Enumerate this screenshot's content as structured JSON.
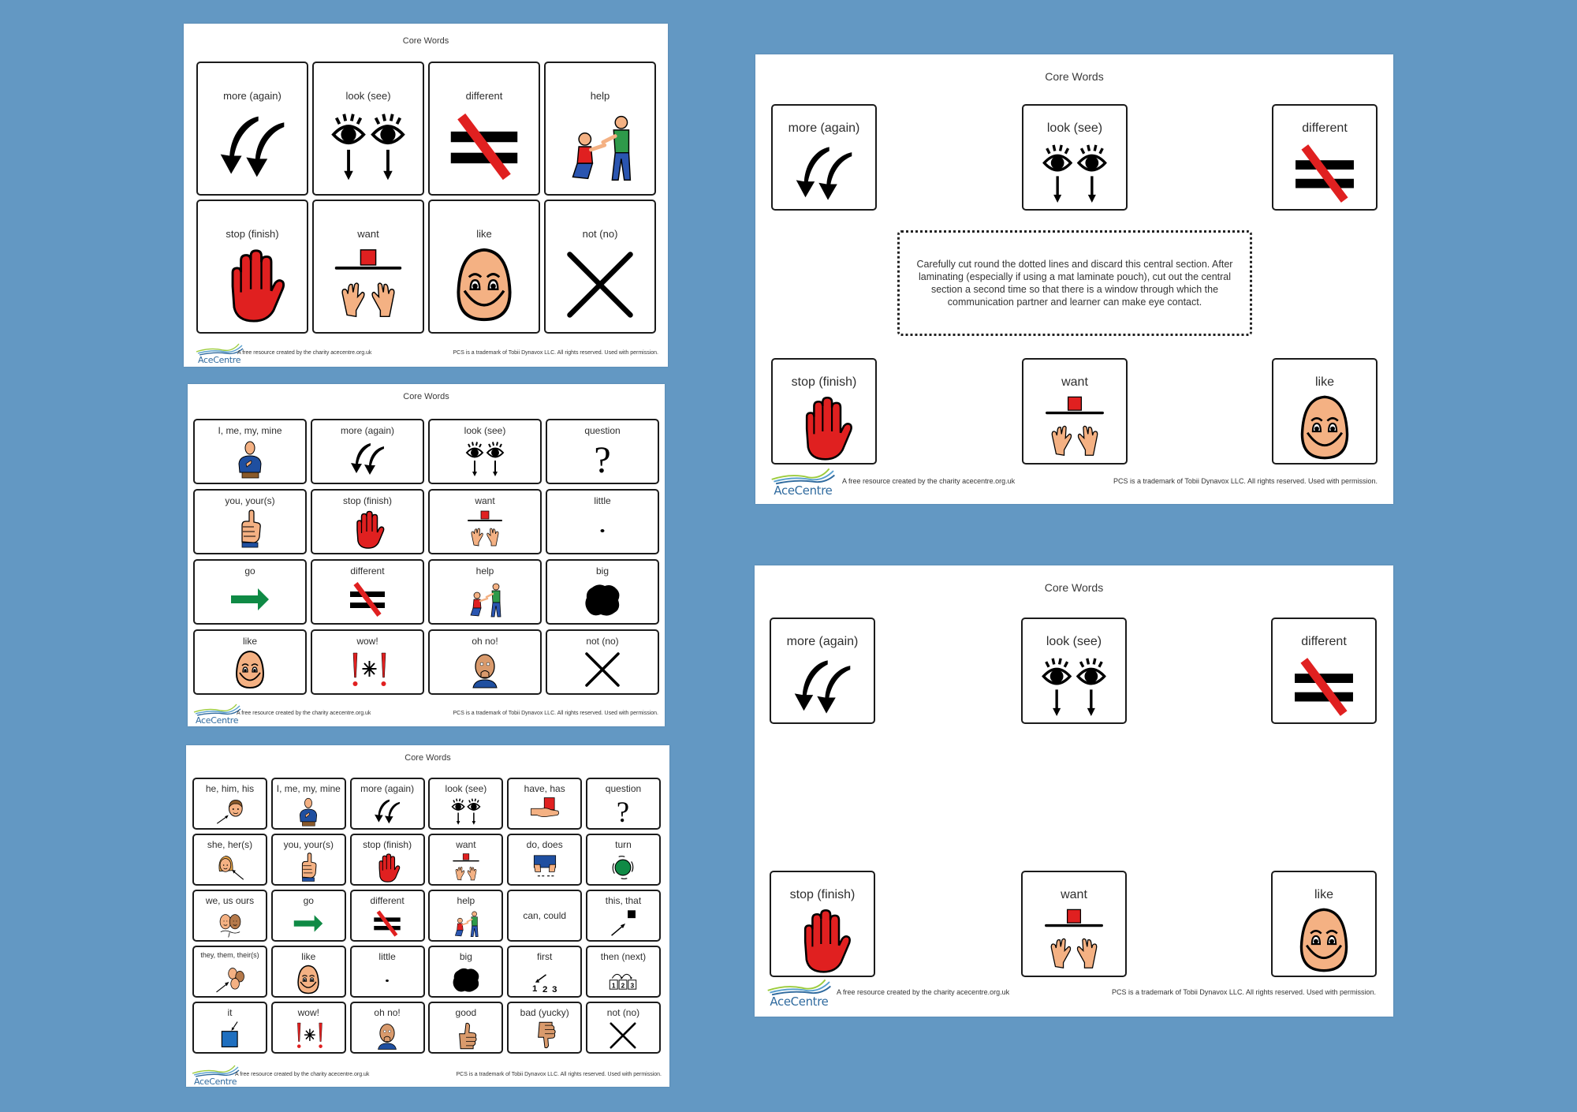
{
  "background_color": "#6398c3",
  "colors": {
    "red": "#e02020",
    "green": "#0f8a45",
    "skin": "#f4b183",
    "blue_shirt": "#1f4fa0",
    "logo_blue": "#2f6a9e",
    "logo_green": "#9ccc3c"
  },
  "footer": {
    "logo_text": "AceCentre",
    "credit": "A free resource created by the charity acecentre.org.uk",
    "trademark": "PCS is a trademark of Tobii Dynavox LLC. All rights reserved. Used with permission."
  },
  "sheets": [
    {
      "id": "s1",
      "title": "Core Words",
      "layout": "grid-4x2",
      "cells": [
        {
          "label": "more (again)",
          "icon": "more-arrows-icon"
        },
        {
          "label": "look (see)",
          "icon": "look-eyes-icon"
        },
        {
          "label": "different",
          "icon": "different-icon"
        },
        {
          "label": "help",
          "icon": "help-people-icon"
        },
        {
          "label": "stop (finish)",
          "icon": "stop-hand-icon"
        },
        {
          "label": "want",
          "icon": "want-icon"
        },
        {
          "label": "like",
          "icon": "like-face-icon"
        },
        {
          "label": "not (no)",
          "icon": "not-cross-icon"
        }
      ]
    },
    {
      "id": "s2",
      "title": "Core Words",
      "layout": "grid-4x4",
      "cells": [
        {
          "label": "I, me, my, mine",
          "icon": "me-person-icon"
        },
        {
          "label": "more (again)",
          "icon": "more-arrows-icon"
        },
        {
          "label": "look (see)",
          "icon": "look-eyes-icon"
        },
        {
          "label": "question",
          "icon": "question-mark-icon"
        },
        {
          "label": "you, your(s)",
          "icon": "you-pointing-icon"
        },
        {
          "label": "stop (finish)",
          "icon": "stop-hand-icon"
        },
        {
          "label": "want",
          "icon": "want-icon"
        },
        {
          "label": "little",
          "icon": "little-dot-icon"
        },
        {
          "label": "go",
          "icon": "go-arrow-icon"
        },
        {
          "label": "different",
          "icon": "different-icon"
        },
        {
          "label": "help",
          "icon": "help-people-icon"
        },
        {
          "label": "big",
          "icon": "big-blob-icon"
        },
        {
          "label": "like",
          "icon": "like-face-icon"
        },
        {
          "label": "wow!",
          "icon": "wow-icon"
        },
        {
          "label": "oh no!",
          "icon": "oh-no-face-icon"
        },
        {
          "label": "not (no)",
          "icon": "not-cross-icon"
        }
      ]
    },
    {
      "id": "s3",
      "title": "Core Words",
      "layout": "grid-6x5",
      "cells": [
        {
          "label": "he, him, his",
          "icon": "he-face-icon"
        },
        {
          "label": "I, me, my, mine",
          "icon": "me-person-icon"
        },
        {
          "label": "more (again)",
          "icon": "more-arrows-icon"
        },
        {
          "label": "look (see)",
          "icon": "look-eyes-icon"
        },
        {
          "label": "have, has",
          "icon": "have-hand-icon"
        },
        {
          "label": "question",
          "icon": "question-mark-icon"
        },
        {
          "label": "she, her(s)",
          "icon": "she-face-icon"
        },
        {
          "label": "you, your(s)",
          "icon": "you-pointing-icon"
        },
        {
          "label": "stop (finish)",
          "icon": "stop-hand-icon"
        },
        {
          "label": "want",
          "icon": "want-icon"
        },
        {
          "label": "do, does",
          "icon": "do-hands-icon"
        },
        {
          "label": "turn",
          "icon": "turn-icon"
        },
        {
          "label": "we, us ours",
          "icon": "we-faces-icon"
        },
        {
          "label": "go",
          "icon": "go-arrow-icon"
        },
        {
          "label": "different",
          "icon": "different-icon"
        },
        {
          "label": "help",
          "icon": "help-people-icon"
        },
        {
          "label": "can, could",
          "icon": ""
        },
        {
          "label": "this, that",
          "icon": "this-that-icon"
        },
        {
          "label": "they, them, their(s)",
          "icon": "they-faces-icon"
        },
        {
          "label": "like",
          "icon": "like-face-icon"
        },
        {
          "label": "little",
          "icon": "little-dot-icon"
        },
        {
          "label": "big",
          "icon": "big-blob-icon"
        },
        {
          "label": "first",
          "icon": "first-icon"
        },
        {
          "label": "then (next)",
          "icon": "then-next-icon"
        },
        {
          "label": "it",
          "icon": "it-square-icon"
        },
        {
          "label": "wow!",
          "icon": "wow-icon"
        },
        {
          "label": "oh no!",
          "icon": "oh-no-face-icon"
        },
        {
          "label": "good",
          "icon": "thumbs-up-icon"
        },
        {
          "label": "bad (yucky)",
          "icon": "thumbs-down-icon"
        },
        {
          "label": "not (no)",
          "icon": "not-cross-icon"
        }
      ]
    },
    {
      "id": "s4",
      "title": "Core Words",
      "layout": "window-with-instructions",
      "instructions": "Carefully cut round the dotted lines and discard this central section. After laminating (especially if using a mat laminate pouch), cut out the central section a second time so that there is a window through which the communication partner and learner can make eye contact.",
      "cells": [
        {
          "label": "more (again)",
          "icon": "more-arrows-icon"
        },
        {
          "label": "look (see)",
          "icon": "look-eyes-icon"
        },
        {
          "label": "different",
          "icon": "different-icon"
        },
        {
          "label": "stop (finish)",
          "icon": "stop-hand-icon"
        },
        {
          "label": "want",
          "icon": "want-icon"
        },
        {
          "label": "like",
          "icon": "like-face-icon"
        }
      ]
    },
    {
      "id": "s5",
      "title": "Core Words",
      "layout": "window",
      "cells": [
        {
          "label": "more (again)",
          "icon": "more-arrows-icon"
        },
        {
          "label": "look (see)",
          "icon": "look-eyes-icon"
        },
        {
          "label": "different",
          "icon": "different-icon"
        },
        {
          "label": "stop (finish)",
          "icon": "stop-hand-icon"
        },
        {
          "label": "want",
          "icon": "want-icon"
        },
        {
          "label": "like",
          "icon": "like-face-icon"
        }
      ]
    }
  ]
}
